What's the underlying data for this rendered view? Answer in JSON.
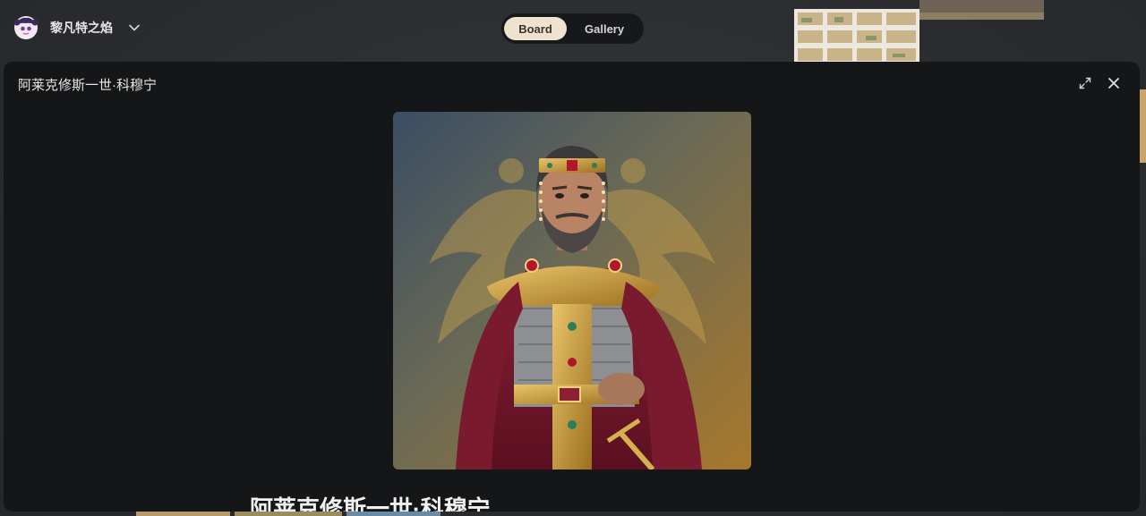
{
  "app": {
    "board_name": "黎凡特之焰",
    "board_icon": "avatar-icon",
    "dropdown_icon": "chevron-down-icon"
  },
  "view_switch": {
    "options": [
      {
        "label": "Board",
        "active": true
      },
      {
        "label": "Gallery",
        "active": false
      }
    ]
  },
  "modal": {
    "title": "阿莱克修斯一世·科穆宁",
    "expand_icon": "expand-icon",
    "close_icon": "close-icon",
    "image_alt": "Byzantine emperor portrait",
    "caption": "阿莱克修斯一世·科穆宁"
  },
  "colors": {
    "accent": "#efe3d0",
    "modal_bg": "#151618",
    "board_bg": "#2b2d31"
  }
}
